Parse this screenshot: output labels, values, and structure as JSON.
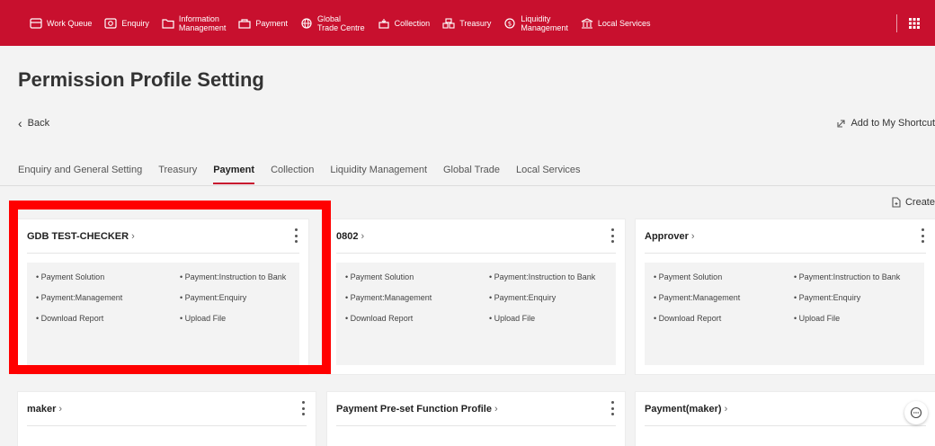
{
  "nav": {
    "items": [
      {
        "label": "Work Queue",
        "icon": "work-queue-icon"
      },
      {
        "label": "Enquiry",
        "icon": "enquiry-icon"
      },
      {
        "label": "Information\nManagement",
        "icon": "folder-icon"
      },
      {
        "label": "Payment",
        "icon": "payment-icon"
      },
      {
        "label": "Global\nTrade Centre",
        "icon": "globe-icon"
      },
      {
        "label": "Collection",
        "icon": "collection-icon"
      },
      {
        "label": "Treasury",
        "icon": "treasury-icon"
      },
      {
        "label": "Liquidity\nManagement",
        "icon": "liquidity-icon"
      },
      {
        "label": "Local Services",
        "icon": "bank-icon"
      }
    ],
    "color": "#c8102e"
  },
  "page": {
    "title": "Permission Profile Setting",
    "back_label": "Back",
    "shortcut_label": "Add to My Shortcut",
    "create_label": "Create"
  },
  "tabs": [
    {
      "label": "Enquiry and General Setting",
      "active": false
    },
    {
      "label": "Treasury",
      "active": false
    },
    {
      "label": "Payment",
      "active": true
    },
    {
      "label": "Collection",
      "active": false
    },
    {
      "label": "Liquidity Management",
      "active": false
    },
    {
      "label": "Global Trade",
      "active": false
    },
    {
      "label": "Local Services",
      "active": false
    }
  ],
  "cards": [
    {
      "title": "GDB TEST-CHECKER",
      "features": [
        "Payment Solution",
        "Payment:Instruction to Bank",
        "Payment:Management",
        "Payment:Enquiry",
        "Download Report",
        "Upload File"
      ]
    },
    {
      "title": "0802",
      "features": [
        "Payment Solution",
        "Payment:Instruction to Bank",
        "Payment:Management",
        "Payment:Enquiry",
        "Download Report",
        "Upload File"
      ]
    },
    {
      "title": "Approver",
      "features": [
        "Payment Solution",
        "Payment:Instruction to Bank",
        "Payment:Management",
        "Payment:Enquiry",
        "Download Report",
        "Upload File"
      ]
    },
    {
      "title": "maker",
      "features": []
    },
    {
      "title": "Payment Pre-set Function Profile",
      "features": []
    },
    {
      "title": "Payment(maker)",
      "features": []
    }
  ],
  "highlight_color": "#ff0000"
}
